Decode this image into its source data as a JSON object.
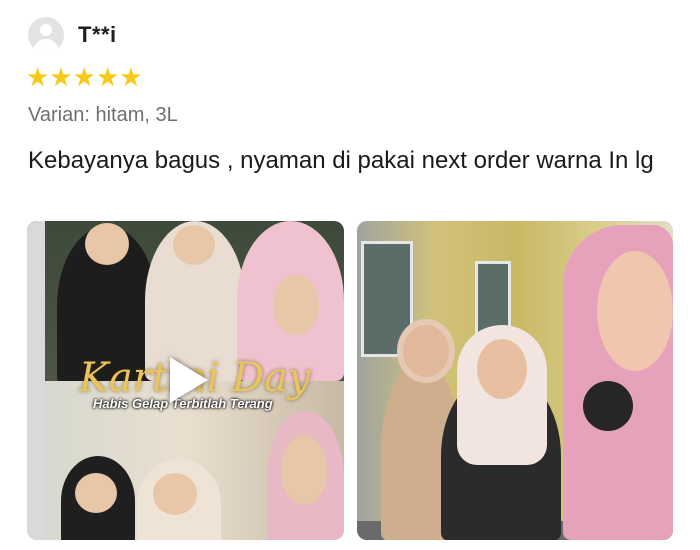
{
  "reviewer": {
    "name": "T**i"
  },
  "rating": {
    "stars": 5,
    "max": 5,
    "star_color": "#f7c918"
  },
  "variant": "Varian: hitam, 3L",
  "review_text": "Kebayanya bagus , nyaman di pakai next order warna In lg",
  "media": {
    "video": {
      "caption_title": "Kartini Day",
      "caption_subtitle": "Habis Gelap Terbitlah Terang",
      "icon": "play-icon"
    },
    "photo": {}
  },
  "colors": {
    "text": "#1a1a1a",
    "muted": "#6f6f6f",
    "accent_star": "#f7c918"
  }
}
